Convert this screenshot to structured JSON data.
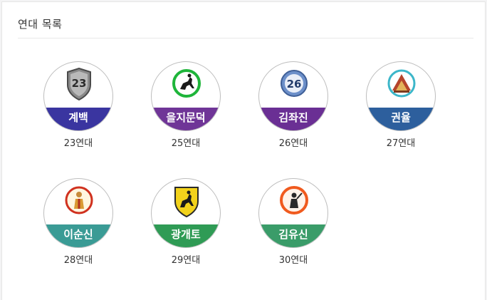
{
  "section": {
    "title": "연대 목록"
  },
  "units": [
    {
      "name": "계백",
      "label": "23연대",
      "band_color": "#3a35a0",
      "icon": "shield-23-icon"
    },
    {
      "name": "을지문덕",
      "label": "25연대",
      "band_color": "#6f3597",
      "icon": "horseman-green-icon"
    },
    {
      "name": "김좌진",
      "label": "26연대",
      "band_color": "#6a2f94",
      "icon": "badge-26-icon"
    },
    {
      "name": "권율",
      "label": "27연대",
      "band_color": "#2d5f9d",
      "icon": "mountain-fortress-icon"
    },
    {
      "name": "이순신",
      "label": "28연대",
      "band_color": "#3a9b95",
      "icon": "admiral-red-icon"
    },
    {
      "name": "광개토",
      "label": "29연대",
      "band_color": "#2f9b55",
      "icon": "horseman-yellow-shield-icon"
    },
    {
      "name": "김유신",
      "label": "30연대",
      "band_color": "#3a9c69",
      "icon": "general-orange-icon"
    }
  ]
}
